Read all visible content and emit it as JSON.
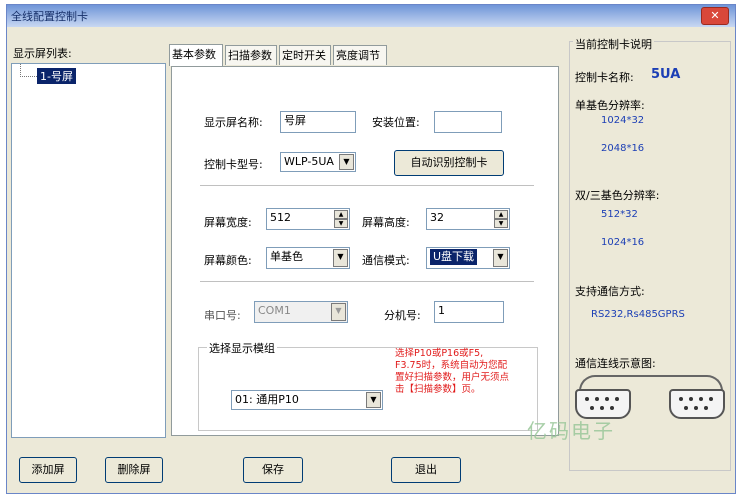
{
  "window": {
    "title": "全线配置控制卡",
    "close_glyph": "✕"
  },
  "screen_list": {
    "label": "显示屏列表:",
    "items": [
      "1-号屏"
    ]
  },
  "tabs": [
    "基本参数",
    "扫描参数",
    "定时开关",
    "亮度调节"
  ],
  "basic": {
    "screen_name_label": "显示屏名称:",
    "screen_name_value": "号屏",
    "install_location_label": "安装位置:",
    "install_location_value": "",
    "card_model_label": "控制卡型号:",
    "card_model_value": "WLP-5UA",
    "auto_detect_button": "自动识别控制卡",
    "width_label": "屏幕宽度:",
    "width_value": "512",
    "height_label": "屏幕高度:",
    "height_value": "32",
    "color_label": "屏幕颜色:",
    "color_value": "单基色",
    "comm_mode_label": "通信模式:",
    "comm_mode_value": "U盘下载",
    "serial_label": "串口号:",
    "serial_value": "COM1",
    "sub_id_label": "分机号:",
    "sub_id_value": "1",
    "module_group_label": "选择显示模组",
    "module_value": "01: 通用P10",
    "module_note": "选择P10或P16或F5, F3.75时，系统自动为您配置好扫描参数，用户无须点击【扫描参数】页。"
  },
  "info": {
    "title": "当前控制卡说明",
    "card_name_label": "控制卡名称:",
    "card_name_value": "5UA",
    "single_res_label": "单基色分辨率:",
    "single_res_values": [
      "1024*32",
      "2048*16"
    ],
    "dual_res_label": "双/三基色分辨率:",
    "dual_res_values": [
      "512*32",
      "1024*16"
    ],
    "comm_support_label": "支持通信方式:",
    "comm_support_value": "RS232,Rs485GPRS",
    "wiring_label": "通信连线示意图:"
  },
  "buttons": {
    "add_screen": "添加屏",
    "delete_screen": "删除屏",
    "save": "保存",
    "exit": "退出"
  },
  "watermark": "亿码电子"
}
